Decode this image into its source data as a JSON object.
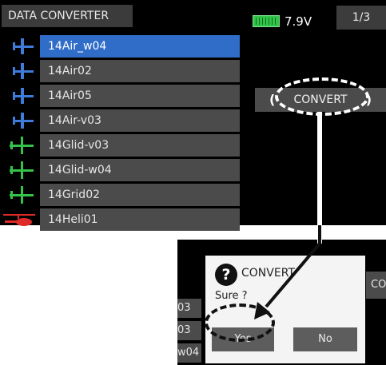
{
  "header": {
    "title": "DATA CONVERTER",
    "voltage": "7.9V",
    "page_indicator": "1/3"
  },
  "model_list": [
    {
      "name": "14Air_w04",
      "icon": "airplane-icon",
      "color": "#3f7bd8",
      "selected": true
    },
    {
      "name": "14Air02",
      "icon": "airplane-icon",
      "color": "#3f7bd8"
    },
    {
      "name": "14Air05",
      "icon": "airplane-icon",
      "color": "#3f7bd8"
    },
    {
      "name": "14Air-v03",
      "icon": "airplane-icon",
      "color": "#3f7bd8"
    },
    {
      "name": "14Glid-v03",
      "icon": "glider-icon",
      "color": "#34c24a"
    },
    {
      "name": "14Glid-w04",
      "icon": "glider-icon",
      "color": "#34c24a"
    },
    {
      "name": "14Grid02",
      "icon": "glider-icon",
      "color": "#34c24a"
    },
    {
      "name": "14Heli01",
      "icon": "helicopter-icon",
      "color": "#e02a2a"
    }
  ],
  "convert_button": {
    "label": "CONVERT",
    "left_bracket": "(",
    "right_bracket": ")"
  },
  "dialog": {
    "icon": "question-icon",
    "title": "CONVERT",
    "message": "Sure ?",
    "yes_label": "Yes",
    "no_label": "No"
  },
  "background_fragments": {
    "left": [
      "03",
      "03",
      "w04"
    ],
    "right": "CO"
  }
}
